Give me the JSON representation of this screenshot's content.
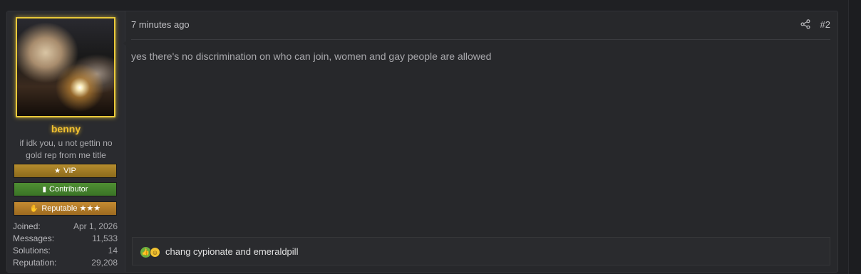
{
  "post": {
    "user": {
      "username": "benny",
      "user_title": "if idk you, u not gettin no gold rep from me title",
      "badges": [
        {
          "label": "VIP",
          "icon": "star-icon",
          "color": "#9e7a25"
        },
        {
          "label": "Contributor",
          "icon": "book-icon",
          "color": "#44812c"
        },
        {
          "label": "Reputable ★★★",
          "icon": "handshake-icon",
          "color": "#b07a28"
        }
      ],
      "stats": [
        {
          "label": "Joined:",
          "value": "Apr 1, 2026"
        },
        {
          "label": "Messages:",
          "value": "11,533"
        },
        {
          "label": "Solutions:",
          "value": "14"
        },
        {
          "label": "Reputation:",
          "value": "29,208"
        }
      ]
    },
    "timestamp": "7 minutes ago",
    "post_number": "#2",
    "message": "yes there's no discrimination on who can join, women and gay people are allowed",
    "reactions": {
      "icons": [
        "thumbs-up-icon",
        "laugh-icon"
      ],
      "text": "chang cypionate and emeraldpill"
    }
  },
  "colors": {
    "page_bg": "#1f2023",
    "post_bg": "#27282b",
    "username": "#f0c030",
    "avatar_border": "#e9c93a"
  }
}
